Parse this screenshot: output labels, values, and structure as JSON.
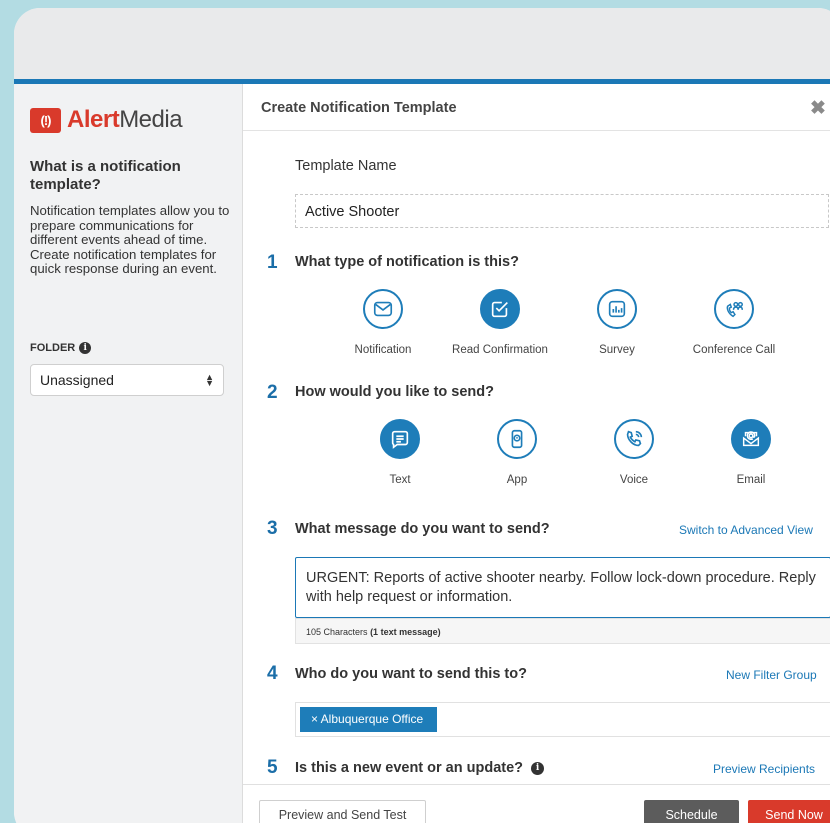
{
  "brand": {
    "logo_mark": "(!)",
    "name_bold": "Alert",
    "name_rest": "Media",
    "color": "#d93a2b"
  },
  "sidebar": {
    "heading": "What is a notification template?",
    "description": "Notification templates allow you to prepare communications for different events ahead of time. Create notification templates for quick response during an event.",
    "folder_label": "FOLDER",
    "folder_value": "Unassigned"
  },
  "modal": {
    "title": "Create Notification Template",
    "close_icon": "close-icon",
    "template_name_label": "Template Name",
    "template_name_value": "Active Shooter"
  },
  "steps": [
    {
      "num": "1",
      "question": "What type of notification is this?"
    },
    {
      "num": "2",
      "question": "How would you like to send?"
    },
    {
      "num": "3",
      "question": "What message do you want to send?",
      "link": "Switch to Advanced View"
    },
    {
      "num": "4",
      "question": "Who do you want to send this to?",
      "link": "New Filter Group"
    },
    {
      "num": "5",
      "question": "Is this a new event or an update?",
      "link": "Preview Recipients"
    }
  ],
  "notification_types": [
    {
      "label": "Notification",
      "icon": "envelope-icon",
      "selected": false
    },
    {
      "label": "Read Confirmation",
      "icon": "checkbox-icon",
      "selected": true
    },
    {
      "label": "Survey",
      "icon": "bar-chart-icon",
      "selected": false
    },
    {
      "label": "Conference Call",
      "icon": "conference-call-icon",
      "selected": false
    }
  ],
  "send_methods": [
    {
      "label": "Text",
      "icon": "message-icon",
      "selected": true
    },
    {
      "label": "App",
      "icon": "phone-app-icon",
      "selected": false
    },
    {
      "label": "Voice",
      "icon": "phone-icon",
      "selected": false
    },
    {
      "label": "Email",
      "icon": "email-icon",
      "selected": true
    }
  ],
  "message": {
    "text": "URGENT: Reports of active shooter nearby. Follow lock-down procedure. Reply with help request or information.",
    "char_count": "105 Characters",
    "msg_count": "(1 text message)"
  },
  "recipients": {
    "chip": "× Albuquerque Office"
  },
  "footer": {
    "preview_btn": "Preview and Send Test",
    "schedule_btn": "Schedule",
    "send_btn": "Send Now"
  },
  "colors": {
    "accent": "#1e7db9",
    "danger": "#d93a2b",
    "schedule": "#5c5c5c"
  }
}
